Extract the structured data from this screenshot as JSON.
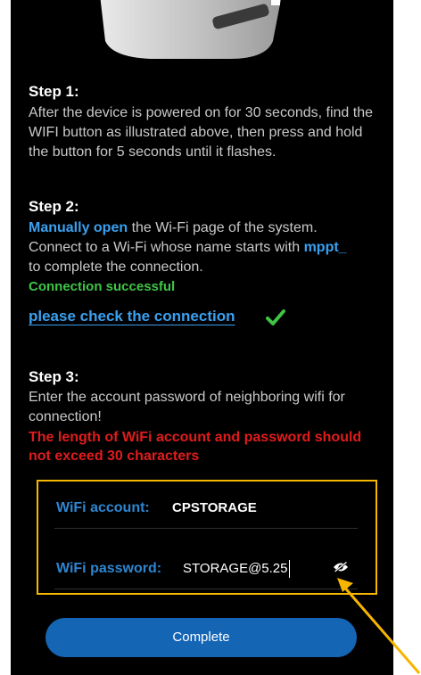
{
  "step1": {
    "title": "Step 1:",
    "text": "After the device is powered on for 30 seconds, find the WIFI button as illustrated above, then press and hold the button for 5 seconds until it flashes."
  },
  "step2": {
    "title": "Step 2:",
    "manual_link": "Manually open",
    "text_a": " the Wi-Fi page of the system.",
    "text_b": "Connect to a Wi-Fi whose name starts with ",
    "prefix": "mppt_",
    "text_c": "to complete the connection.",
    "status": "Connection successful",
    "check_link": "please check the connection"
  },
  "step3": {
    "title": "Step 3:",
    "text": "Enter the account password of neighboring wifi for connection!",
    "warning": "The length of WiFi account and password should not exceed 30 characters"
  },
  "form": {
    "account_label": "WiFi account:",
    "account_value": "CPSTORAGE",
    "password_label": "WiFi password:",
    "password_value": "STORAGE@5.25"
  },
  "complete_label": "Complete",
  "colors": {
    "highlight_border": "#f5b700",
    "accent_blue": "#3aa0f0",
    "button_blue": "#1565b5",
    "success_green": "#3fc545",
    "warning_red": "#e01c1c"
  }
}
